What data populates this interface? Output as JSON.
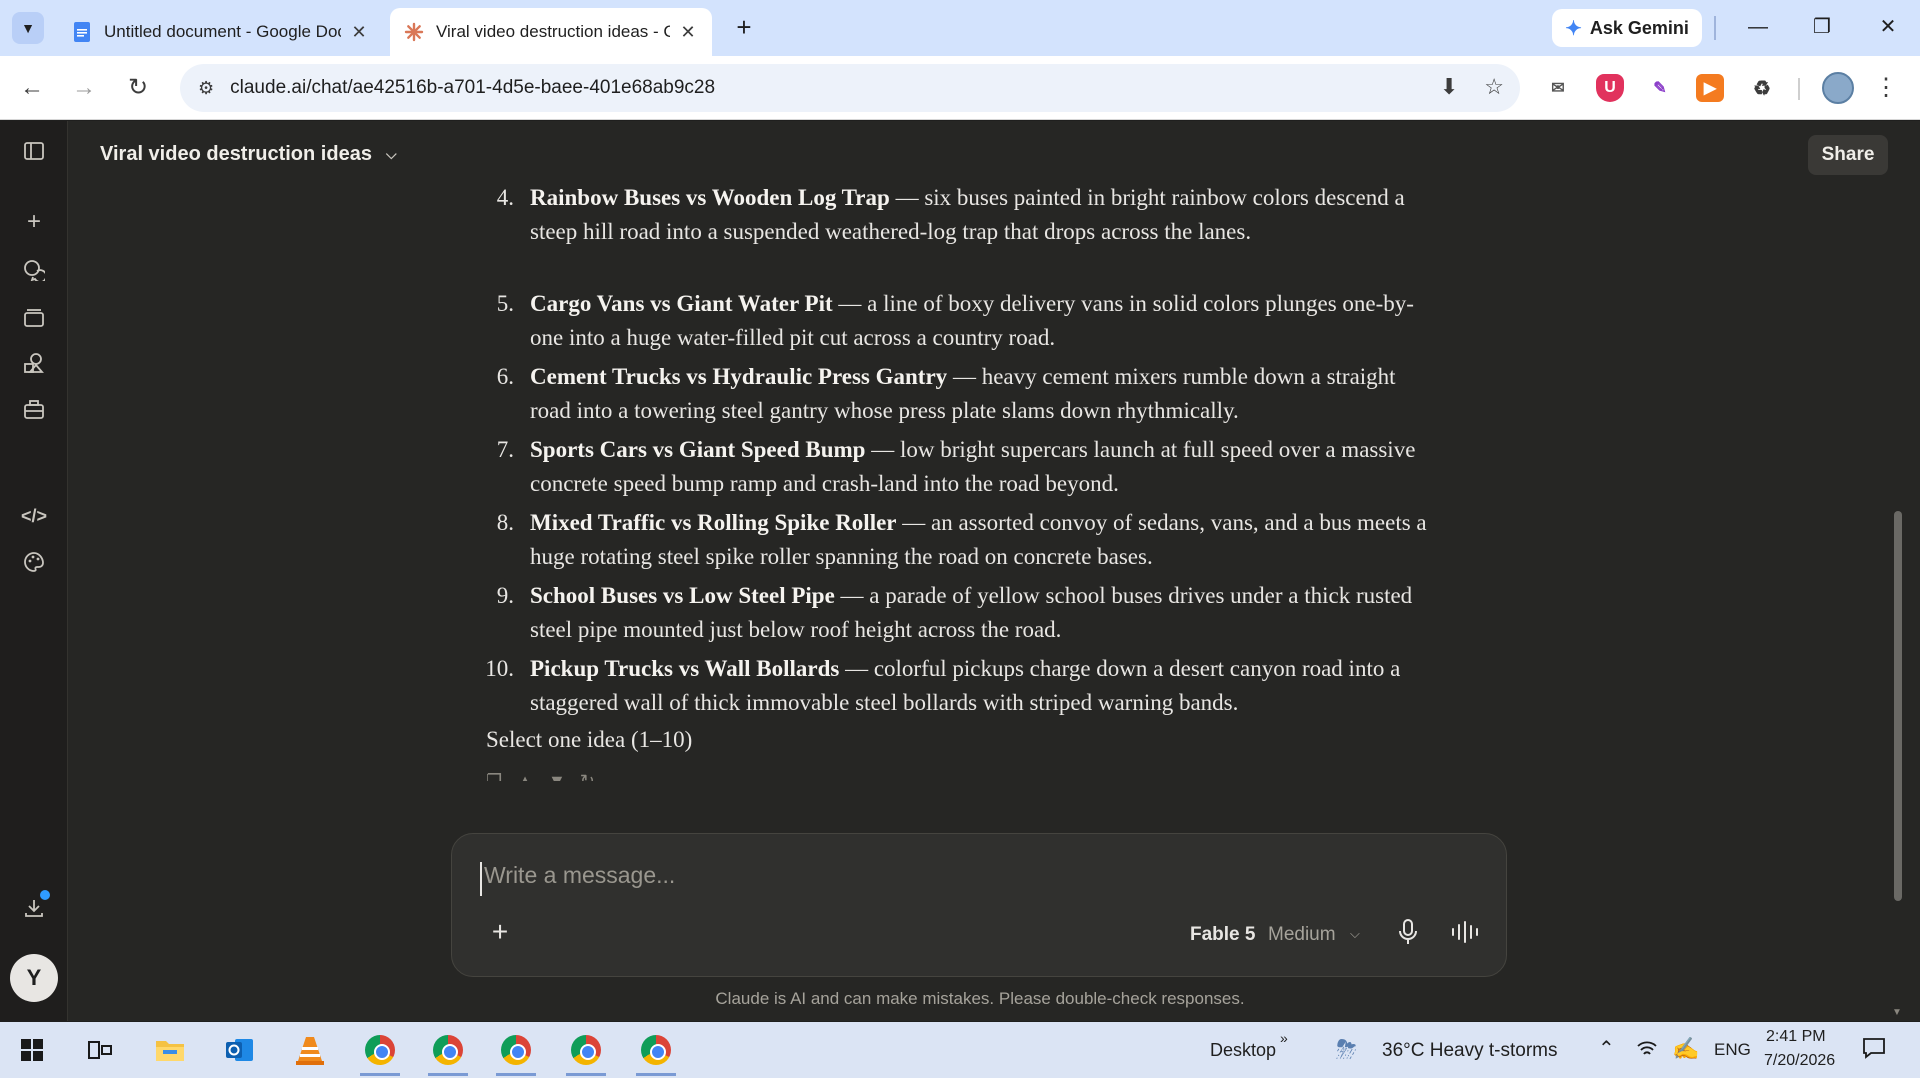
{
  "browser": {
    "tabs": [
      {
        "title": "Untitled document - Google Docs",
        "active": false
      },
      {
        "title": "Viral video destruction ideas - Claude",
        "active": true
      }
    ],
    "ask_gemini": "Ask Gemini",
    "url": "claude.ai/chat/ae42516b-a701-4d5e-baee-401e68ab9c28"
  },
  "app": {
    "chat_title": "Viral video destruction ideas",
    "share_label": "Share",
    "user_initial": "Y",
    "ideas": [
      {
        "num": "4.",
        "title": "Rainbow Buses vs Wooden Log Trap",
        "desc": " — six buses painted in bright rainbow colors descend a steep hill road into a suspended weathered-log trap that drops across the lanes."
      },
      {
        "num": "5.",
        "title": "Cargo Vans vs Giant Water Pit",
        "desc": " — a line of boxy delivery vans in solid colors plunges one-by-one into a huge water-filled pit cut across a country road."
      },
      {
        "num": "6.",
        "title": "Cement Trucks vs Hydraulic Press Gantry",
        "desc": " — heavy cement mixers rumble down a straight road into a towering steel gantry whose press plate slams down rhythmically."
      },
      {
        "num": "7.",
        "title": "Sports Cars vs Giant Speed Bump",
        "desc": " — low bright supercars launch at full speed over a massive concrete speed bump ramp and crash-land into the road beyond."
      },
      {
        "num": "8.",
        "title": "Mixed Traffic vs Rolling Spike Roller",
        "desc": " — an assorted convoy of sedans, vans, and a bus meets a huge rotating steel spike roller spanning the road on concrete bases."
      },
      {
        "num": "9.",
        "title": "School Buses vs Low Steel Pipe",
        "desc": " — a parade of yellow school buses drives under a thick rusted steel pipe mounted just below roof height across the road."
      },
      {
        "num": "10.",
        "title": "Pickup Trucks vs Wall Bollards",
        "desc": " — colorful pickups charge down a desert canyon road into a staggered wall of thick immovable steel bollards with striped warning bands."
      }
    ],
    "select_prompt": "Select one idea (1–10)",
    "composer": {
      "placeholder": "Write a message...",
      "model": "Fable 5",
      "effort": "Medium"
    },
    "disclaimer": "Claude is AI and can make mistakes. Please double-check responses."
  },
  "taskbar": {
    "desktop_label": "Desktop",
    "weather": "36°C  Heavy t-storms",
    "language": "ENG",
    "time": "2:41 PM",
    "date": "7/20/2026"
  },
  "colors": {
    "accent_claude": "#d97757",
    "browser_tab_bar": "#d3e3fd",
    "app_background": "#262624"
  }
}
